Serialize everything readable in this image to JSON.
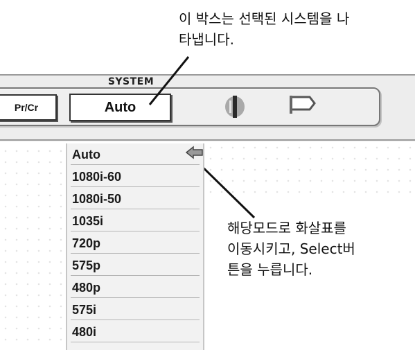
{
  "callouts": {
    "top_line1": "이 박스는 선택된 시스템을 나",
    "top_line2": "타냅니다.",
    "bottom_line1": "해당모드로 화살표를",
    "bottom_line2": "이동시키고, Select버",
    "bottom_line3": "튼을 누릅니다."
  },
  "panel": {
    "title": "SYSTEM",
    "prev_button_label": "Pr/Cr",
    "selected_system": "Auto",
    "icons": [
      "split-screen-icon",
      "screen-icon"
    ]
  },
  "menu": {
    "items": [
      "Auto",
      "1080i-60",
      "1080i-50",
      "1035i",
      "720p",
      "575p",
      "480p",
      "575i",
      "480i"
    ],
    "selected_index": 0,
    "pointer_icon": "left-arrow-pointer-icon"
  },
  "colors": {
    "panel_bg": "#efefef",
    "text": "#111111",
    "icon_fill": "#a9a9a9"
  }
}
